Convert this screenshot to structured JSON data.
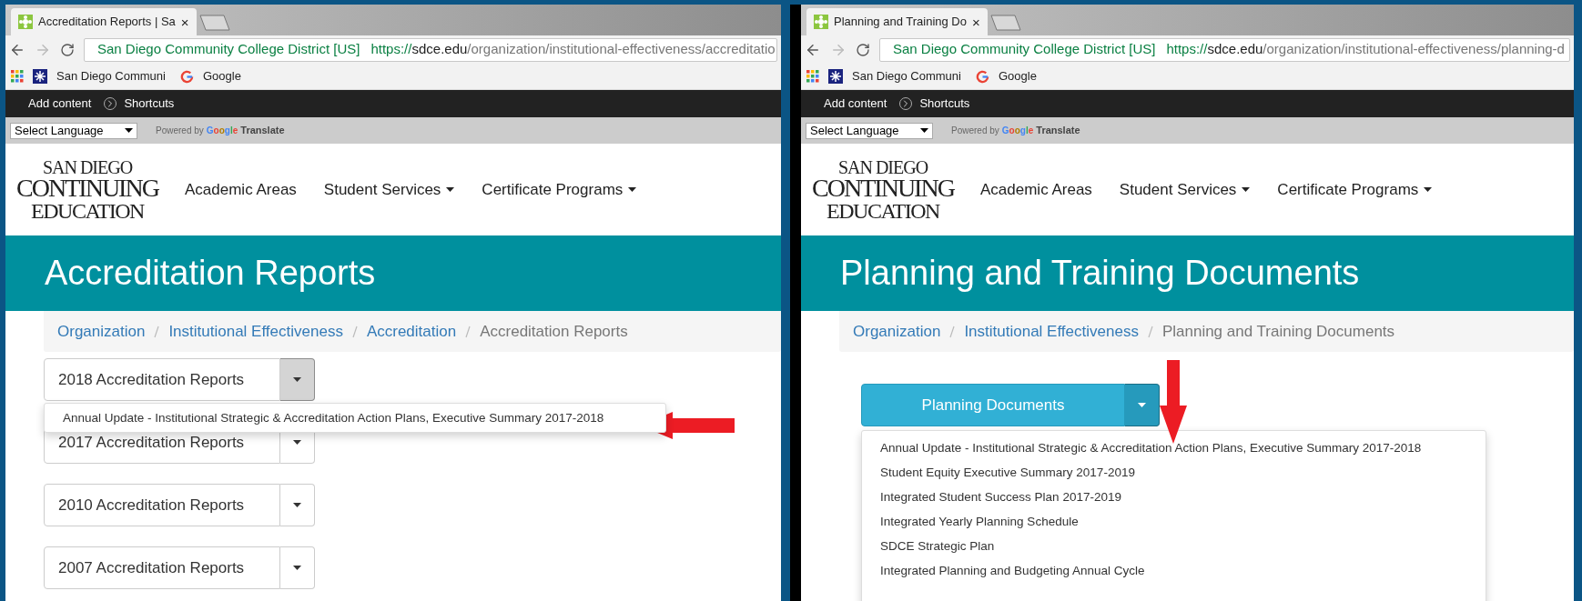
{
  "panels": [
    {
      "tab": {
        "title": "Accreditation Reports | Sa",
        "close": "×"
      },
      "address": {
        "identity": "San Diego Community College District [US]",
        "scheme": "https://",
        "host": "sdce.edu",
        "path": "/organization/institutional-effectiveness/accreditatio"
      },
      "bookmarks": [
        "San Diego Communi",
        "Google"
      ],
      "admin_bar": {
        "add_content": "Add content",
        "shortcuts": "Shortcuts"
      },
      "language_bar": {
        "select": "Select Language",
        "powered_by": "Powered by",
        "google": "Google",
        "translate": "Translate"
      },
      "logo": [
        "SAN DIEGO",
        "CONTINUING",
        "EDUCATION"
      ],
      "nav": [
        {
          "label": "Academic Areas",
          "dropdown": false
        },
        {
          "label": "Student Services",
          "dropdown": true
        },
        {
          "label": "Certificate Programs",
          "dropdown": true
        }
      ],
      "hero_title": "Accreditation Reports",
      "breadcrumb": [
        {
          "label": "Organization",
          "current": false
        },
        {
          "label": "Institutional Effectiveness",
          "current": false
        },
        {
          "label": "Accreditation",
          "current": false
        },
        {
          "label": "Accreditation Reports",
          "current": true
        }
      ],
      "content": {
        "kind": "default",
        "groups": [
          {
            "label": "2018 Accreditation Reports",
            "open": true,
            "menu_items": [
              "Annual Update - Institutional Strategic & Accreditation Action Plans, Executive Summary 2017-2018"
            ]
          },
          {
            "label": "2017 Accreditation Reports",
            "open": false
          },
          {
            "label": "2010 Accreditation Reports",
            "open": false
          },
          {
            "label": "2007 Accreditation Reports",
            "open": false
          }
        ]
      }
    },
    {
      "tab": {
        "title": "Planning and Training Do",
        "close": "×"
      },
      "address": {
        "identity": "San Diego Community College District [US]",
        "scheme": "https://",
        "host": "sdce.edu",
        "path": "/organization/institutional-effectiveness/planning-d"
      },
      "bookmarks": [
        "San Diego Communi",
        "Google"
      ],
      "admin_bar": {
        "add_content": "Add content",
        "shortcuts": "Shortcuts"
      },
      "language_bar": {
        "select": "Select Language",
        "powered_by": "Powered by",
        "google": "Google",
        "translate": "Translate"
      },
      "logo": [
        "SAN DIEGO",
        "CONTINUING",
        "EDUCATION"
      ],
      "nav": [
        {
          "label": "Academic Areas",
          "dropdown": false
        },
        {
          "label": "Student Services",
          "dropdown": true
        },
        {
          "label": "Certificate Programs",
          "dropdown": true
        }
      ],
      "hero_title": "Planning and Training Documents",
      "breadcrumb": [
        {
          "label": "Organization",
          "current": false
        },
        {
          "label": "Institutional Effectiveness",
          "current": false
        },
        {
          "label": "Planning and Training Documents",
          "current": true
        }
      ],
      "content": {
        "kind": "primary",
        "groups": [
          {
            "label": "Planning Documents",
            "open": true,
            "menu_items": [
              "Annual Update - Institutional Strategic & Accreditation Action Plans, Executive Summary 2017-2018",
              "Student Equity Executive Summary 2017-2019",
              "Integrated Student Success Plan 2017-2019",
              "Integrated Yearly Planning Schedule",
              "SDCE Strategic Plan",
              "Integrated Planning and Budgeting Annual Cycle"
            ]
          }
        ]
      }
    }
  ]
}
